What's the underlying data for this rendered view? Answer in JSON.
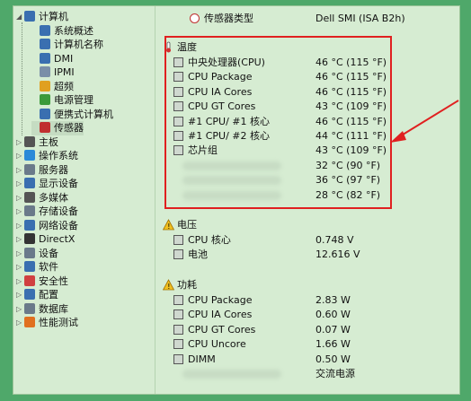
{
  "tree": {
    "items": [
      {
        "label": "计算机",
        "icon": "computer-icon",
        "color": "#3a6fb0"
      },
      {
        "label": "系统概述",
        "icon": "summary-icon",
        "color": "#3a6fb0"
      },
      {
        "label": "计算机名称",
        "icon": "computer-name-icon",
        "color": "#3a6fb0"
      },
      {
        "label": "DMI",
        "icon": "dmi-icon",
        "color": "#3a6fb0"
      },
      {
        "label": "IPMI",
        "icon": "ipmi-icon",
        "color": "#7a8fa8"
      },
      {
        "label": "超频",
        "icon": "overclock-icon",
        "color": "#e0a020"
      },
      {
        "label": "电源管理",
        "icon": "power-icon",
        "color": "#3a9a3a"
      },
      {
        "label": "便携式计算机",
        "icon": "laptop-icon",
        "color": "#3a6fb0"
      },
      {
        "label": "传感器",
        "icon": "sensor-icon",
        "color": "#c03030"
      },
      {
        "label": "主板",
        "icon": "motherboard-icon",
        "color": "#555555"
      },
      {
        "label": "操作系统",
        "icon": "windows-icon",
        "color": "#2a8ad8"
      },
      {
        "label": "服务器",
        "icon": "server-icon",
        "color": "#6a7a8a"
      },
      {
        "label": "显示设备",
        "icon": "display-icon",
        "color": "#3a6fb0"
      },
      {
        "label": "多媒体",
        "icon": "multimedia-icon",
        "color": "#555555"
      },
      {
        "label": "存储设备",
        "icon": "storage-icon",
        "color": "#6a7a8a"
      },
      {
        "label": "网络设备",
        "icon": "network-icon",
        "color": "#3a6fb0"
      },
      {
        "label": "DirectX",
        "icon": "directx-icon",
        "color": "#333333"
      },
      {
        "label": "设备",
        "icon": "devices-icon",
        "color": "#6a7a8a"
      },
      {
        "label": "软件",
        "icon": "software-icon",
        "color": "#3a6fb0"
      },
      {
        "label": "安全性",
        "icon": "security-icon",
        "color": "#d04040"
      },
      {
        "label": "配置",
        "icon": "config-icon",
        "color": "#3a6fb0"
      },
      {
        "label": "数据库",
        "icon": "database-icon",
        "color": "#6a7a8a"
      },
      {
        "label": "性能测试",
        "icon": "benchmark-icon",
        "color": "#e07020"
      }
    ]
  },
  "sensor_type": {
    "label": "传感器类型",
    "value": "Dell SMI  (ISA B2h)"
  },
  "temperature": {
    "title": "温度",
    "rows": [
      {
        "name": "中央处理器(CPU)",
        "value": "46 °C  (115 °F)"
      },
      {
        "name": "CPU Package",
        "value": "46 °C  (115 °F)"
      },
      {
        "name": "CPU IA Cores",
        "value": "46 °C  (115 °F)"
      },
      {
        "name": "CPU GT Cores",
        "value": "43 °C  (109 °F)"
      },
      {
        "name": "#1 CPU/ #1 核心",
        "value": "46 °C  (115 °F)"
      },
      {
        "name": "#1 CPU/ #2 核心",
        "value": "44 °C  (111 °F)"
      },
      {
        "name": "芯片组",
        "value": "43 °C  (109 °F)"
      },
      {
        "name": "",
        "value": "32 °C  (90 °F)"
      },
      {
        "name": "",
        "value": "36 °C  (97 °F)"
      },
      {
        "name": "",
        "value": "28 °C  (82 °F)"
      }
    ]
  },
  "voltage": {
    "title": "电压",
    "rows": [
      {
        "name": "CPU 核心",
        "value": "0.748 V"
      },
      {
        "name": "电池",
        "value": "12.616 V"
      }
    ]
  },
  "power": {
    "title": "功耗",
    "rows": [
      {
        "name": "CPU Package",
        "value": "2.83 W"
      },
      {
        "name": "CPU IA Cores",
        "value": "0.60 W"
      },
      {
        "name": "CPU GT Cores",
        "value": "0.07 W"
      },
      {
        "name": "CPU Uncore",
        "value": "1.66 W"
      },
      {
        "name": "DIMM",
        "value": "0.50 W"
      },
      {
        "name": "",
        "value": "交流电源"
      }
    ]
  },
  "colors": {
    "annotation": "#e02020",
    "background": "#d6ecd2",
    "outer": "#4fa86a"
  }
}
